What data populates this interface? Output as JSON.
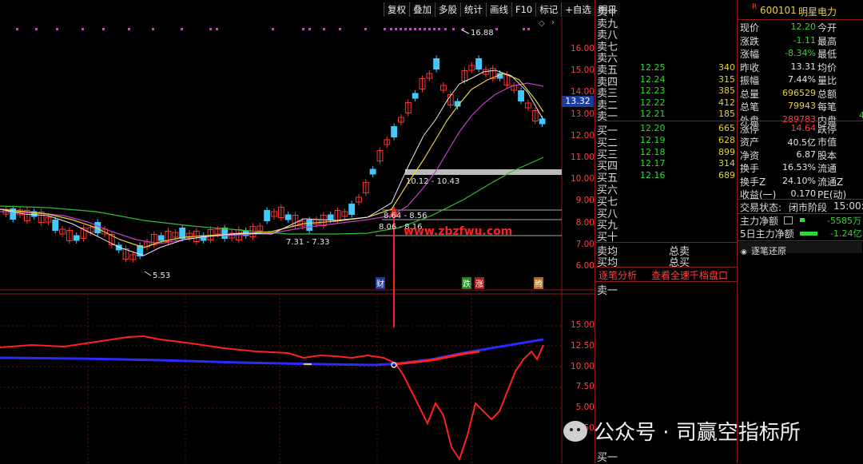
{
  "toolbar": {
    "buttons": [
      "复权",
      "叠加",
      "多股",
      "统计",
      "画线",
      "F10",
      "标记",
      "+自选",
      "明日"
    ],
    "settings_icon": "diamond-icon"
  },
  "main_chart": {
    "y_ticks": [
      "16.00",
      "15.00",
      "14.00",
      "13.00",
      "12.00",
      "11.00",
      "10.00",
      "9.00",
      "8.00",
      "7.00",
      "6.00"
    ],
    "current_price_tag": "13.32",
    "high_label": "16.88",
    "low_label": "5.53",
    "range_labels": [
      "10.12 - 10.43",
      "8.64 - 8.56",
      "8.06 - 8.16",
      "7.31 - 7.33"
    ],
    "watermark_url": "www.zbzfwu.com",
    "event_badges": [
      "财",
      "跌",
      "涨",
      "腾"
    ]
  },
  "indicator_chart": {
    "y_ticks": [
      "15.00",
      "12.50",
      "10.00",
      "7.50",
      "5.00",
      "2.50"
    ]
  },
  "order_book": {
    "sell_labels": [
      "卖十",
      "卖九",
      "卖八",
      "卖七",
      "卖六",
      "卖五",
      "卖四",
      "卖三",
      "卖二",
      "卖一"
    ],
    "sell_prices": [
      "",
      "",
      "",
      "",
      "",
      "12.25",
      "12.24",
      "12.23",
      "12.22",
      "12.21"
    ],
    "sell_vols": [
      "",
      "",
      "",
      "",
      "",
      "340",
      "315",
      "385",
      "412",
      "185"
    ],
    "buy_labels": [
      "买一",
      "买二",
      "买三",
      "买四",
      "买五",
      "买六",
      "买七",
      "买八",
      "买九",
      "买十"
    ],
    "buy_prices": [
      "12.20",
      "12.19",
      "12.18",
      "12.17",
      "12.16",
      "",
      "",
      "",
      "",
      ""
    ],
    "buy_vols": [
      "665",
      "628",
      "899",
      "314",
      "689",
      "",
      "",
      "",
      "",
      ""
    ],
    "sell_avg": "卖均",
    "buy_avg": "买均",
    "total_sell": "总卖",
    "total_buy": "总买",
    "tab_tick_analysis": "逐笔分析",
    "tab_full_depth": "查看全速千档盘口",
    "bottom_sell": "卖一",
    "bottom_buy": "买一"
  },
  "quote": {
    "code": "600101",
    "name": "明星电力",
    "flag": "R",
    "rows": [
      {
        "label": "现价",
        "value": "12.20",
        "right": "今开"
      },
      {
        "label": "涨跌",
        "value": "-1.11",
        "right": "最高"
      },
      {
        "label": "涨幅",
        "value": "-8.34%",
        "right": "最低"
      },
      {
        "label": "昨收",
        "value": "13.31",
        "right": "均价"
      },
      {
        "label": "振幅",
        "value": "7.44%",
        "right": "量比"
      },
      {
        "label": "总量",
        "value": "696529",
        "right": "总额"
      },
      {
        "label": "总笔",
        "value": "79943",
        "right": "每笔"
      },
      {
        "label": "外盘",
        "value": "289783",
        "right": "内盘"
      },
      {
        "label": "涨停",
        "value": "14.64",
        "right": "跌停"
      },
      {
        "label": "资产",
        "value": "40.5亿",
        "right": "市值"
      },
      {
        "label": "净资",
        "value": "6.87",
        "right": "股本"
      },
      {
        "label": "换手",
        "value": "16.53%",
        "right": "流通"
      },
      {
        "label": "换手Z",
        "value": "24.10%",
        "right": "流通Z"
      },
      {
        "label": "收益(一)",
        "value": "0.170",
        "right": "PE(动)"
      }
    ],
    "inner_vol_partial": "4",
    "trade_status_label": "交易状态:",
    "trade_status_value": "闭市阶段",
    "trade_time": "15:00:0",
    "main_net_label": "主力净额",
    "main_net_value": "-5585万",
    "main5_label": "5日主力净额",
    "main5_value": "-1.24亿",
    "tick_restore": "逐笔还原"
  },
  "footer_watermark": "公众号 · 司赢空指标所",
  "colors": {
    "up": "#ff4040",
    "down": "#33d633",
    "border": "#8a1a1a",
    "vol": "#e6d23a",
    "ma_blue": "#2828ff"
  }
}
